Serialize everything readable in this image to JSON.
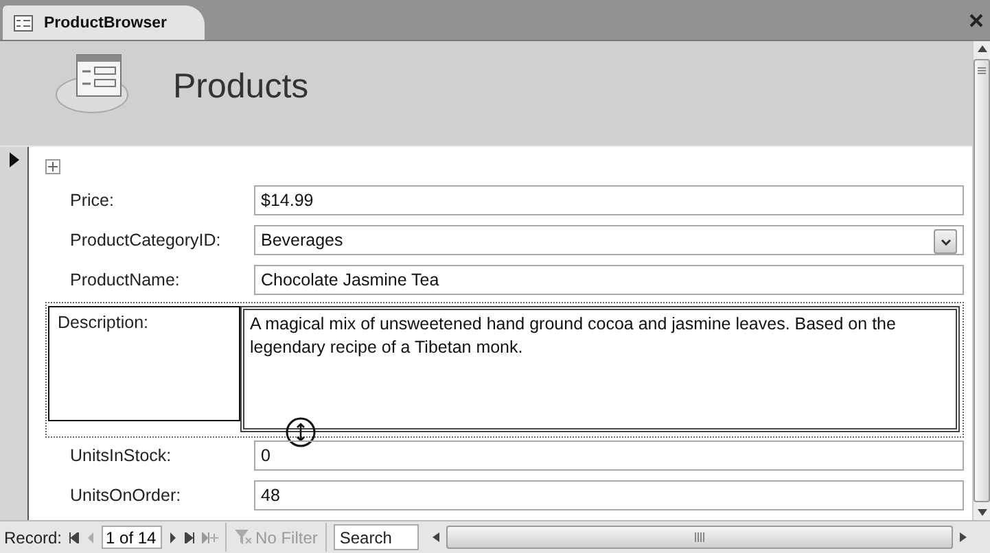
{
  "tab": {
    "title": "ProductBrowser"
  },
  "header": {
    "title": "Products"
  },
  "fields": [
    {
      "label": "Price:",
      "kind": "text",
      "value": "$14.99",
      "selected": false
    },
    {
      "label": "ProductCategoryID:",
      "kind": "combo",
      "value": "Beverages",
      "selected": false
    },
    {
      "label": "ProductName:",
      "kind": "text",
      "value": "Chocolate Jasmine Tea",
      "selected": false
    },
    {
      "label": "Description:",
      "kind": "memo",
      "value": "A magical mix of unsweetened hand ground cocoa and jasmine leaves. Based on the legendary recipe of a Tibetan monk.",
      "selected": true
    },
    {
      "label": "UnitsInStock:",
      "kind": "text",
      "value": "0",
      "selected": false
    },
    {
      "label": "UnitsOnOrder:",
      "kind": "text",
      "value": "48",
      "selected": false
    }
  ],
  "navigation": {
    "label": "Record:",
    "position": "1 of 14",
    "filter": {
      "label": "No Filter",
      "disabled": true
    },
    "search": {
      "placeholder": "Search"
    }
  }
}
